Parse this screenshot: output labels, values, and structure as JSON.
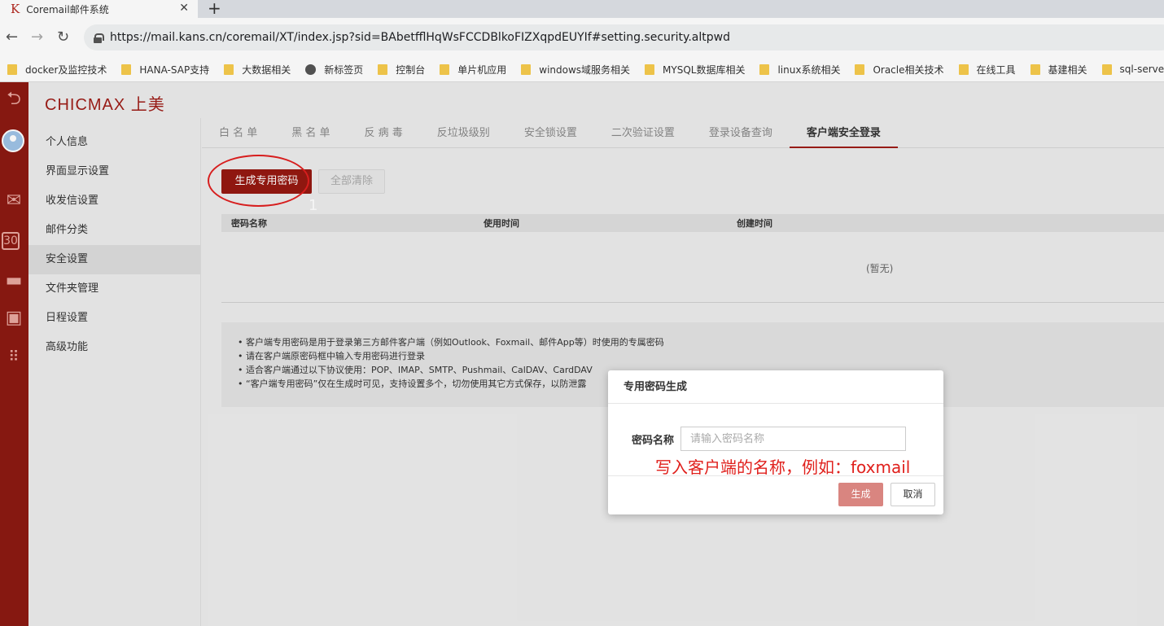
{
  "browser": {
    "tab_title": "Coremail邮件系统",
    "tab_favicon": "K",
    "url": "https://mail.kans.cn/coremail/XT/index.jsp?sid=BAbetfflHqWsFCCDBlkoFIZXqpdEUYIf#setting.security.altpwd",
    "bookmarks": [
      {
        "label": "docker及监控技术",
        "icon": "folder"
      },
      {
        "label": "HANA-SAP支持",
        "icon": "folder"
      },
      {
        "label": "大数据相关",
        "icon": "folder"
      },
      {
        "label": "新标签页",
        "icon": "globe"
      },
      {
        "label": "控制台",
        "icon": "folder"
      },
      {
        "label": "单片机应用",
        "icon": "folder"
      },
      {
        "label": "windows域服务相关",
        "icon": "folder"
      },
      {
        "label": "MYSQL数据库相关",
        "icon": "folder"
      },
      {
        "label": "linux系统相关",
        "icon": "folder"
      },
      {
        "label": "Oracle相关技术",
        "icon": "folder"
      },
      {
        "label": "在线工具",
        "icon": "folder"
      },
      {
        "label": "基建相关",
        "icon": "folder"
      },
      {
        "label": "sql-server",
        "icon": "folder"
      }
    ]
  },
  "app": {
    "logo": "CHICMAX 上美",
    "sidebar": [
      {
        "label": "个人信息"
      },
      {
        "label": "界面显示设置"
      },
      {
        "label": "收发信设置"
      },
      {
        "label": "邮件分类"
      },
      {
        "label": "安全设置",
        "active": true
      },
      {
        "label": "文件夹管理"
      },
      {
        "label": "日程设置"
      },
      {
        "label": "高级功能"
      }
    ],
    "subtabs": [
      {
        "label": "白 名 单"
      },
      {
        "label": "黑 名 单"
      },
      {
        "label": "反 病 毒"
      },
      {
        "label": "反垃圾级别"
      },
      {
        "label": "安全锁设置"
      },
      {
        "label": "二次验证设置"
      },
      {
        "label": "登录设备查询"
      },
      {
        "label": "客户端安全登录",
        "active": true
      }
    ],
    "generate_btn": "生成专用密码",
    "clear_btn": "全部清除",
    "annotation_number": "1",
    "table": {
      "col_name": "密码名称",
      "col_used": "使用时间",
      "col_created": "创建时间",
      "empty": "(暂无)"
    },
    "notes": [
      "• 客户端专用密码是用于登录第三方邮件客户端（例如Outlook、Foxmail、邮件App等）时使用的专属密码",
      "• 请在客户端原密码框中输入专用密码进行登录",
      "• 适合客户端通过以下协议使用：POP、IMAP、SMTP、Pushmail、CalDAV、CardDAV",
      "• “客户端专用密码”仅在生成时可见，支持设置多个，切勿使用其它方式保存，以防泄露"
    ]
  },
  "dialog": {
    "title": "专用密码生成",
    "label": "密码名称",
    "placeholder": "请输入密码名称",
    "note": "写入客户端的名称，例如：foxmail",
    "generate": "生成",
    "cancel": "取消"
  }
}
